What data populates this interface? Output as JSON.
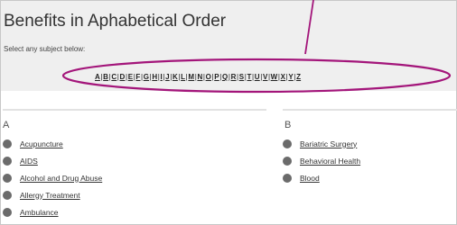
{
  "header": {
    "title": "Benefits in Aphabetical Order",
    "instruction": "Select any subject below:"
  },
  "az_nav": {
    "letters": [
      "A",
      "B",
      "C",
      "D",
      "E",
      "F",
      "G",
      "H",
      "I",
      "J",
      "K",
      "L",
      "M",
      "N",
      "O",
      "P",
      "Q",
      "R",
      "S",
      "T",
      "U",
      "V",
      "W",
      "X",
      "Y",
      "Z"
    ],
    "separator": "|"
  },
  "sections": [
    {
      "letter": "A",
      "items": [
        "Acupuncture",
        "AIDS",
        "Alcohol and Drug Abuse",
        "Allergy Treatment",
        "Ambulance"
      ]
    },
    {
      "letter": "B",
      "items": [
        "Bariatric Surgery",
        "Behavioral Health",
        "Blood"
      ]
    }
  ],
  "colors": {
    "annotation": "#a3157a",
    "panel": "#efefef",
    "bullet": "#6b6b6b"
  }
}
